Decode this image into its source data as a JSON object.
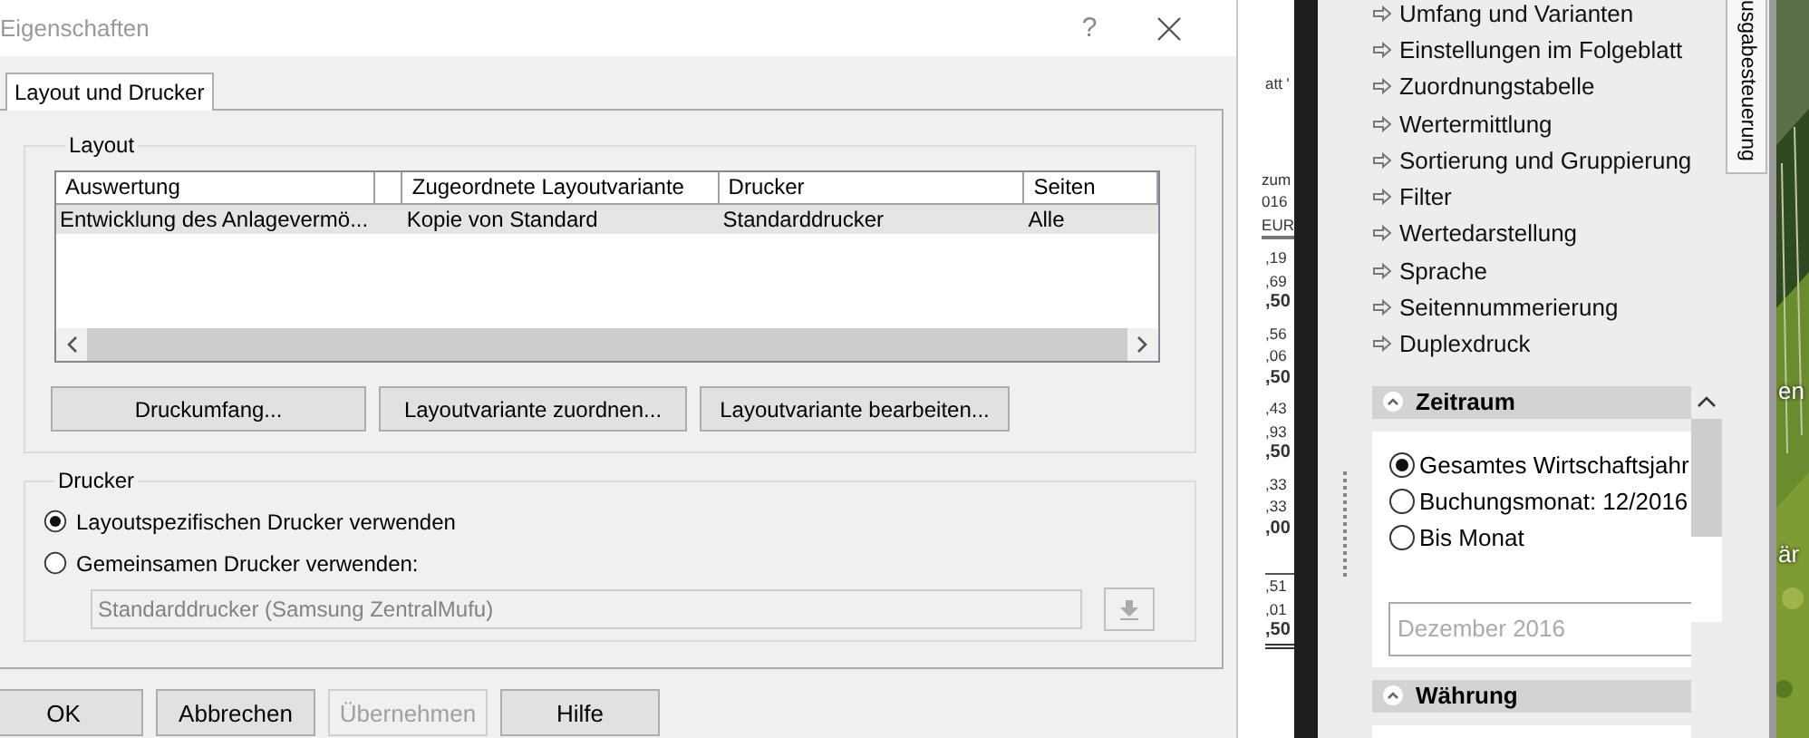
{
  "dialog": {
    "title": "Eigenschaften",
    "help_button": "?",
    "tabs": [
      {
        "label": "Layout und Drucker",
        "selected": true
      }
    ],
    "layout_group": {
      "title": "Layout",
      "table": {
        "columns": [
          "Auswertung",
          "Zugeordnete Layoutvariante",
          "Drucker",
          "Seiten"
        ],
        "rows": [
          {
            "cells": [
              "Entwicklung des Anlagevermö...",
              "Kopie von Standard",
              "Standarddrucker",
              "Alle"
            ],
            "selected": true
          }
        ]
      },
      "buttons": [
        "Druckumfang...",
        "Layoutvariante zuordnen...",
        "Layoutvariante bearbeiten..."
      ]
    },
    "printer_group": {
      "title": "Drucker",
      "options": [
        {
          "label": "Layoutspezifischen Drucker verwenden",
          "selected": true
        },
        {
          "label": "Gemeinsamen Drucker verwenden:",
          "selected": false
        }
      ],
      "printer_field": {
        "value": "Standarddrucker (Samsung ZentralMufu)",
        "disabled": true
      }
    },
    "footer_buttons": [
      {
        "label": "OK",
        "disabled": false
      },
      {
        "label": "Abbrechen",
        "disabled": false
      },
      {
        "label": "Übernehmen",
        "disabled": true
      },
      {
        "label": "Hilfe",
        "disabled": false
      }
    ]
  },
  "background_document": {
    "groups": [
      [
        {
          "text": "att '",
          "bold": false
        }
      ],
      [
        {
          "text": "zum",
          "bold": false
        },
        {
          "text": "016",
          "bold": false
        },
        {
          "text": "EUR",
          "bold": false
        }
      ],
      [
        {
          "text": ",19",
          "bold": false
        },
        {
          "text": ",69",
          "bold": false
        },
        {
          "text": ",50",
          "bold": true
        }
      ],
      [
        {
          "text": ",56",
          "bold": false
        },
        {
          "text": ",06",
          "bold": false
        },
        {
          "text": ",50",
          "bold": true
        }
      ],
      [
        {
          "text": ",43",
          "bold": false
        },
        {
          "text": ",93",
          "bold": false
        },
        {
          "text": ",50",
          "bold": true
        }
      ],
      [
        {
          "text": ",33",
          "bold": false
        },
        {
          "text": ",33",
          "bold": false
        },
        {
          "text": ",00",
          "bold": true
        }
      ],
      [
        {
          "text": ",51",
          "bold": false
        },
        {
          "text": ",01",
          "bold": false
        },
        {
          "text": ",50",
          "bold": true
        }
      ]
    ]
  },
  "side_panel": {
    "links": [
      "Umfang und Varianten",
      "Einstellungen im Folgeblatt",
      "Zuordnungstabelle",
      "Wertermittlung",
      "Sortierung und Gruppierung",
      "Filter",
      "Wertedarstellung",
      "Sprache",
      "Seitennummerierung",
      "Duplexdruck"
    ],
    "sections": [
      {
        "title": "Zeitraum",
        "expanded": true,
        "options": [
          {
            "label": "Gesamtes Wirtschaftsjahr",
            "selected": true
          },
          {
            "label": "Buchungsmonat: 12/2016",
            "selected": false
          },
          {
            "label": "Bis Monat",
            "selected": false
          }
        ],
        "month_field": {
          "value": "Dezember 2016",
          "disabled": true
        }
      },
      {
        "title": "Währung",
        "expanded": true
      }
    ],
    "side_tab": {
      "label": "usgabesteuerung"
    }
  },
  "desktop_labels": [
    "en",
    "är"
  ]
}
